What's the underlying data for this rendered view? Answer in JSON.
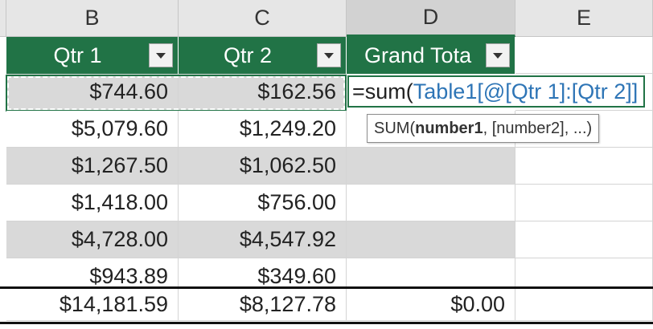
{
  "columns": [
    "B",
    "C",
    "D",
    "E"
  ],
  "table": {
    "headers": [
      "Qtr 1",
      "Qtr 2",
      "Grand Tota"
    ],
    "rows": [
      [
        "$744.60",
        "$162.56"
      ],
      [
        "$5,079.60",
        "$1,249.20"
      ],
      [
        "$1,267.50",
        "$1,062.50"
      ],
      [
        "$1,418.00",
        "$756.00"
      ],
      [
        "$4,728.00",
        "$4,547.92"
      ],
      [
        "$943.89",
        "$349.60"
      ]
    ],
    "totals": [
      "$14,181.59",
      "$8,127.78",
      "$0.00"
    ]
  },
  "formula": {
    "eq": "=",
    "func": "sum(",
    "ref": "Table1[@[Qtr 1]:[Qtr 2]]"
  },
  "tooltip": {
    "func": "SUM(",
    "arg1": "number1",
    "rest": ", [number2], ...)"
  },
  "colors": {
    "header_green": "#217346",
    "band_gray": "#d9d9d9",
    "ref_blue": "#2e75b6"
  },
  "icons": [
    "filter-dropdown-icon"
  ]
}
